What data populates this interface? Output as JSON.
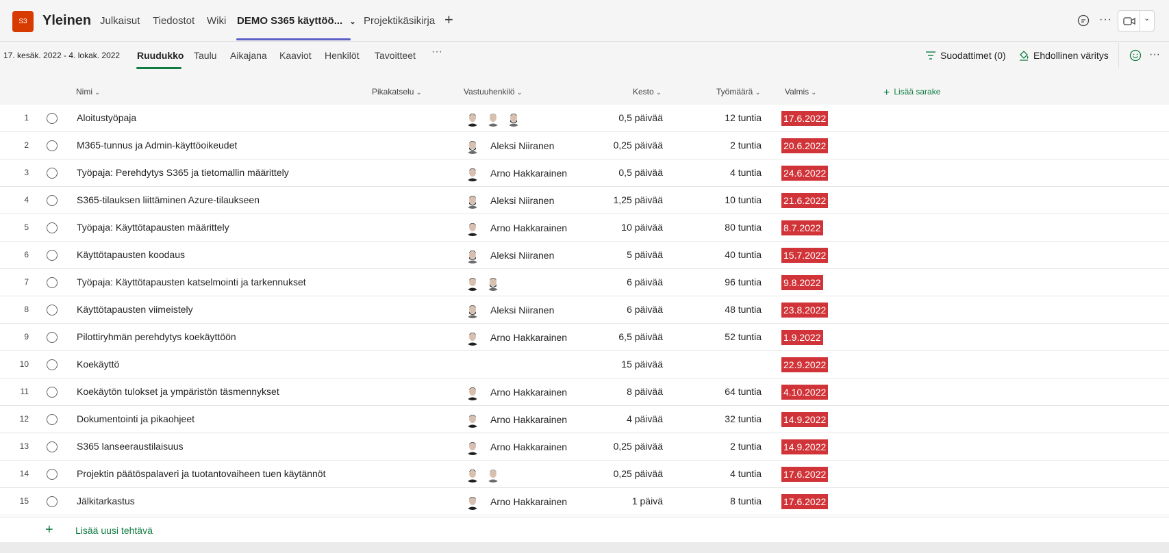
{
  "header": {
    "team_badge": "S3",
    "channel": "Yleinen",
    "tabs": [
      "Julkaisut",
      "Tiedostot",
      "Wiki",
      "DEMO S365 käyttöö...",
      "Projektikäsikirja"
    ],
    "active_tab": "DEMO S365 käyttöö...",
    "add_tab": "+"
  },
  "subbar": {
    "date_range": "17. kesäk. 2022 - 4. lokak. 2022",
    "views": [
      "Ruudukko",
      "Taulu",
      "Aikajana",
      "Kaaviot",
      "Henkilöt",
      "Tavoitteet"
    ],
    "active_view": "Ruudukko",
    "more": "···",
    "filters": "Suodattimet (0)",
    "conditional": "Ehdollinen väritys"
  },
  "columns": {
    "name": "Nimi",
    "quicklook": "Pikakatselu",
    "assignee": "Vastuuhenkilö",
    "duration": "Kesto",
    "effort": "Työmäärä",
    "due": "Valmis",
    "add": "Lisää sarake"
  },
  "due_color": "#d13438",
  "accent": "#107c41",
  "tasks": [
    {
      "n": "1",
      "name": "Aloitustyöpaja",
      "assignee": "",
      "avatars": [
        "arno",
        "aleksi-grey",
        "aleksi"
      ],
      "duration": "0,5 päivää",
      "effort": "12 tuntia",
      "due": "17.6.2022"
    },
    {
      "n": "2",
      "name": "M365-tunnus ja Admin-käyttöoikeudet",
      "assignee": "Aleksi Niiranen",
      "avatars": [
        "aleksi"
      ],
      "duration": "0,25 päivää",
      "effort": "2 tuntia",
      "due": "20.6.2022"
    },
    {
      "n": "3",
      "name": "Työpaja: Perehdytys S365 ja tietomallin määrittely",
      "assignee": "Arno Hakkarainen",
      "avatars": [
        "arno"
      ],
      "duration": "0,5 päivää",
      "effort": "4 tuntia",
      "due": "24.6.2022"
    },
    {
      "n": "4",
      "name": "S365-tilauksen liittäminen Azure-tilaukseen",
      "assignee": "Aleksi Niiranen",
      "avatars": [
        "aleksi"
      ],
      "duration": "1,25 päivää",
      "effort": "10 tuntia",
      "due": "21.6.2022"
    },
    {
      "n": "5",
      "name": "Työpaja: Käyttötapausten määrittely",
      "assignee": "Arno Hakkarainen",
      "avatars": [
        "arno"
      ],
      "duration": "10 päivää",
      "effort": "80 tuntia",
      "due": "8.7.2022"
    },
    {
      "n": "6",
      "name": "Käyttötapausten koodaus",
      "assignee": "Aleksi Niiranen",
      "avatars": [
        "aleksi"
      ],
      "duration": "5 päivää",
      "effort": "40 tuntia",
      "due": "15.7.2022"
    },
    {
      "n": "7",
      "name": "Työpaja: Käyttötapausten katselmointi ja tarkennukset",
      "assignee": "",
      "avatars": [
        "arno",
        "aleksi"
      ],
      "duration": "6 päivää",
      "effort": "96 tuntia",
      "due": "9.8.2022"
    },
    {
      "n": "8",
      "name": "Käyttötapausten viimeistely",
      "assignee": "Aleksi Niiranen",
      "avatars": [
        "aleksi"
      ],
      "duration": "6 päivää",
      "effort": "48 tuntia",
      "due": "23.8.2022"
    },
    {
      "n": "9",
      "name": "Pilottiryhmän perehdytys koekäyttöön",
      "assignee": "Arno Hakkarainen",
      "avatars": [
        "arno"
      ],
      "duration": "6,5 päivää",
      "effort": "52 tuntia",
      "due": "1.9.2022"
    },
    {
      "n": "10",
      "name": "Koekäyttö",
      "assignee": "",
      "avatars": [],
      "duration": "15 päivää",
      "effort": "",
      "due": "22.9.2022"
    },
    {
      "n": "11",
      "name": "Koekäytön tulokset ja ympäristön täsmennykset",
      "assignee": "Arno Hakkarainen",
      "avatars": [
        "arno"
      ],
      "duration": "8 päivää",
      "effort": "64 tuntia",
      "due": "4.10.2022"
    },
    {
      "n": "12",
      "name": "Dokumentointi ja pikaohjeet",
      "assignee": "Arno Hakkarainen",
      "avatars": [
        "arno"
      ],
      "duration": "4 päivää",
      "effort": "32 tuntia",
      "due": "14.9.2022"
    },
    {
      "n": "13",
      "name": "S365 lanseeraustilaisuus",
      "assignee": "Arno Hakkarainen",
      "avatars": [
        "arno"
      ],
      "duration": "0,25 päivää",
      "effort": "2 tuntia",
      "due": "14.9.2022"
    },
    {
      "n": "14",
      "name": "Projektin päätöspalaveri ja tuotantovaiheen tuen käytännöt",
      "assignee": "",
      "avatars": [
        "arno",
        "aleksi-grey"
      ],
      "duration": "0,25 päivää",
      "effort": "4 tuntia",
      "due": "17.6.2022"
    },
    {
      "n": "15",
      "name": "Jälkitarkastus",
      "assignee": "Arno Hakkarainen",
      "avatars": [
        "arno"
      ],
      "duration": "1 päivä",
      "effort": "8 tuntia",
      "due": "17.6.2022"
    }
  ],
  "add_task": "Lisää uusi tehtävä"
}
